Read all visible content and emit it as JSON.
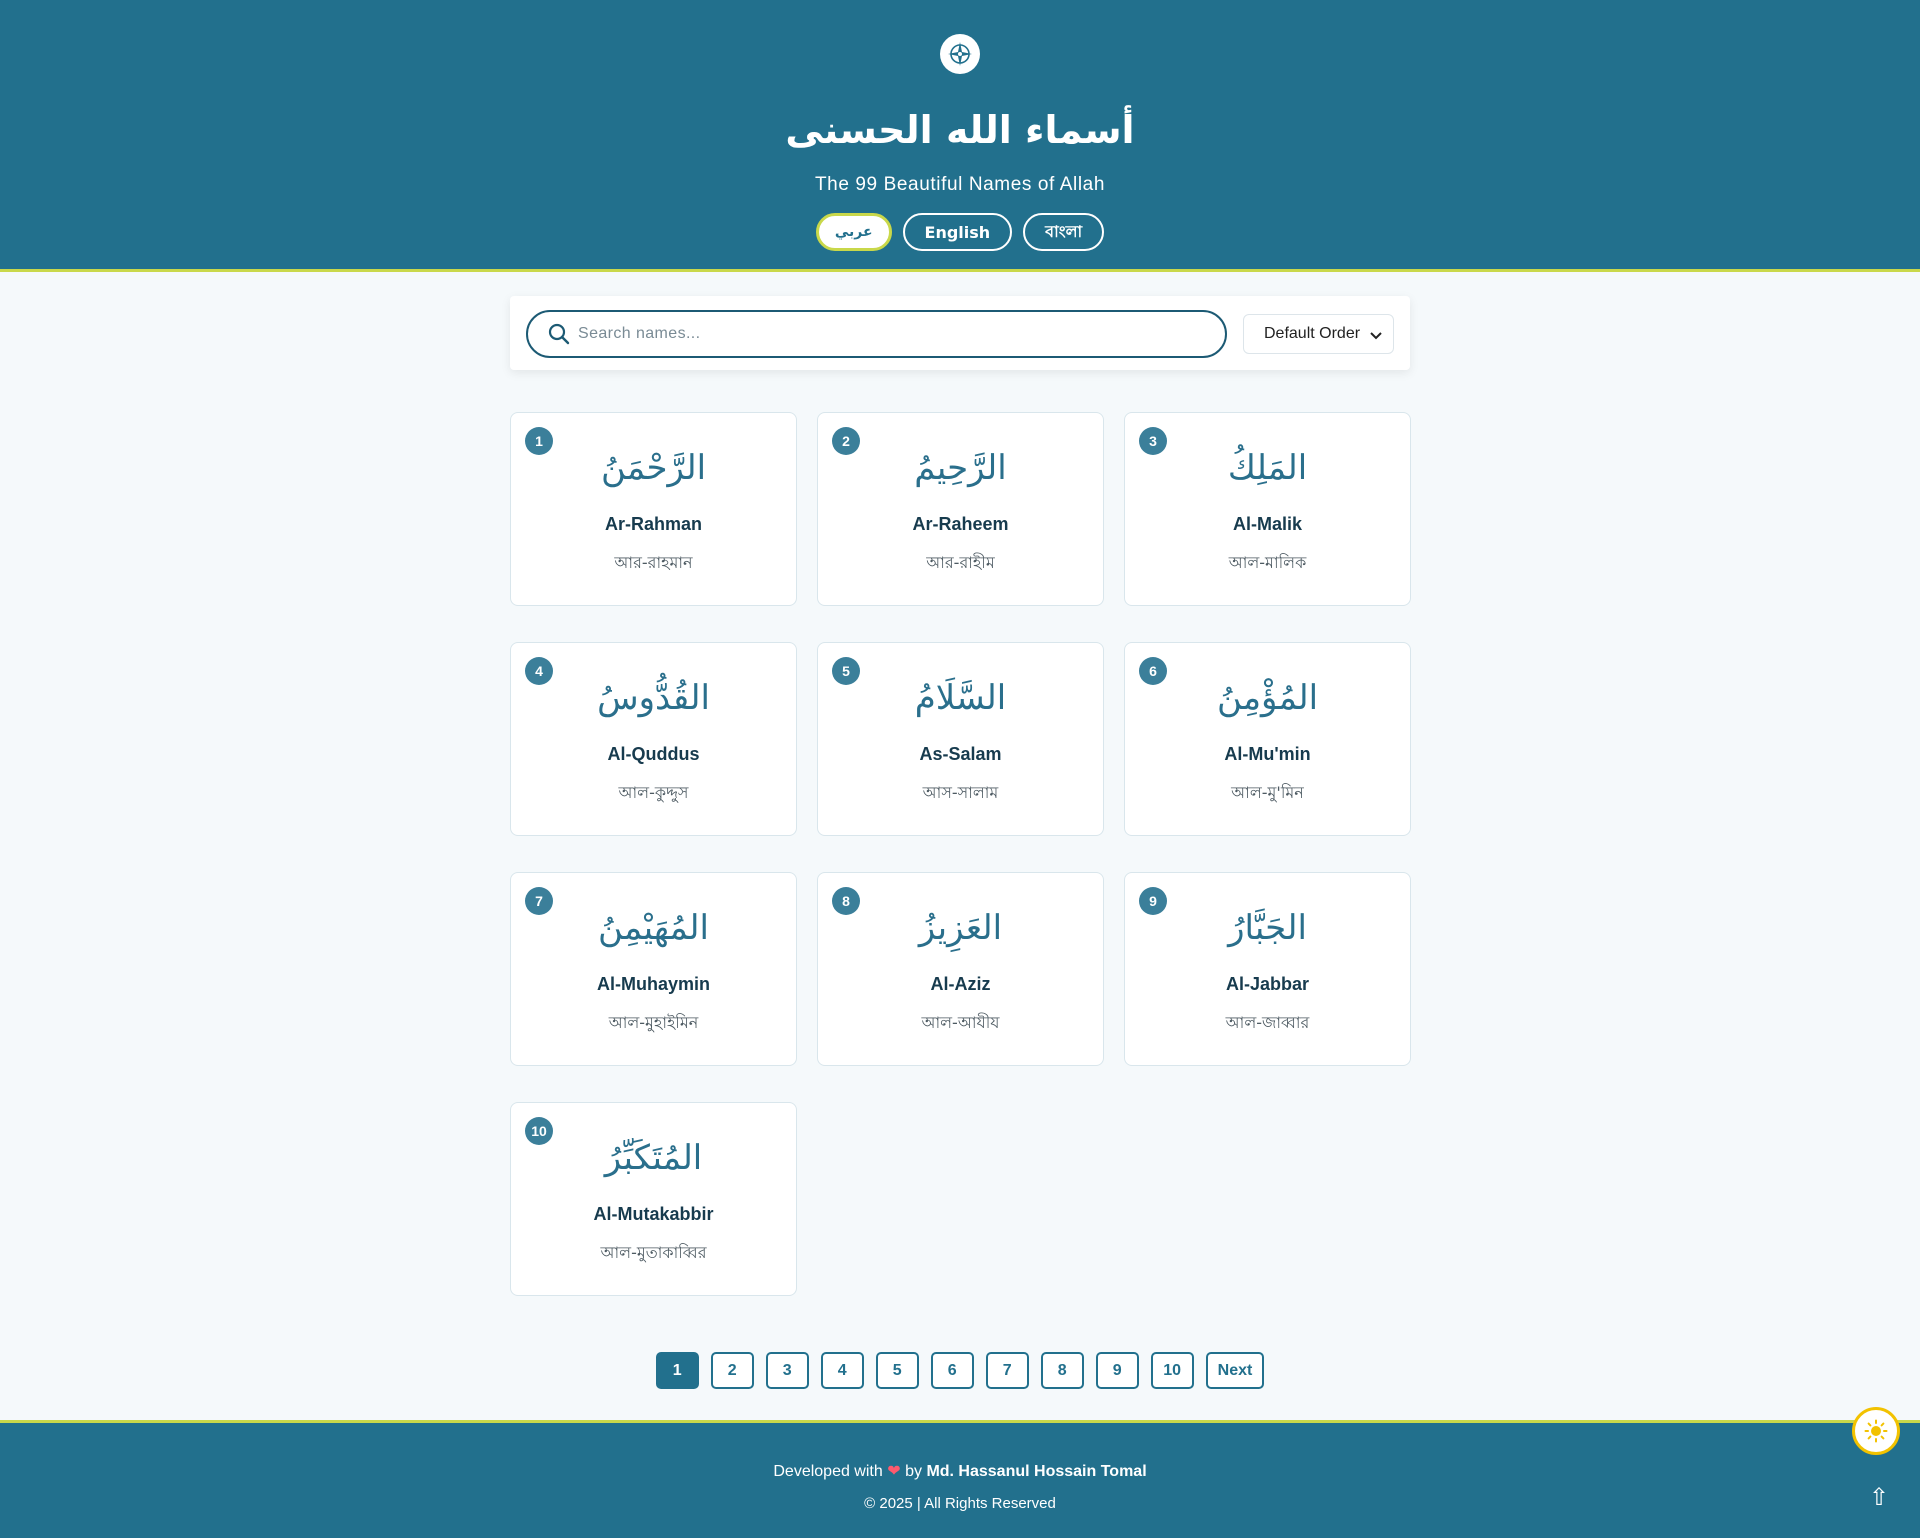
{
  "header": {
    "logo_icon": "compass-icon",
    "title_arabic": "أسماء الله الحسنى",
    "subtitle": "The 99 Beautiful Names of Allah",
    "languages": [
      {
        "label": "عربي",
        "active": true
      },
      {
        "label": "English",
        "active": false
      },
      {
        "label": "বাংলা",
        "active": false
      }
    ]
  },
  "search": {
    "placeholder": "Search names...",
    "value": "",
    "sort_selected": "Default Order"
  },
  "names": [
    {
      "number": "1",
      "arabic": "الرَّحْمَنُ",
      "english": "Ar-Rahman",
      "bengali": "আর-রাহমান"
    },
    {
      "number": "2",
      "arabic": "الرَّحِيمُ",
      "english": "Ar-Raheem",
      "bengali": "আর-রাহীম"
    },
    {
      "number": "3",
      "arabic": "المَلِكُ",
      "english": "Al-Malik",
      "bengali": "আল-মালিক"
    },
    {
      "number": "4",
      "arabic": "القُدُّوسُ",
      "english": "Al-Quddus",
      "bengali": "আল-কুদ্দুস"
    },
    {
      "number": "5",
      "arabic": "السَّلَامُ",
      "english": "As-Salam",
      "bengali": "আস-সালাম"
    },
    {
      "number": "6",
      "arabic": "المُؤْمِنُ",
      "english": "Al-Mu'min",
      "bengali": "আল-মু'মিন"
    },
    {
      "number": "7",
      "arabic": "المُهَيْمِنُ",
      "english": "Al-Muhaymin",
      "bengali": "আল-মুহাইমিন"
    },
    {
      "number": "8",
      "arabic": "العَزِيزُ",
      "english": "Al-Aziz",
      "bengali": "আল-আযীয"
    },
    {
      "number": "9",
      "arabic": "الجَبَّارُ",
      "english": "Al-Jabbar",
      "bengali": "আল-জাব্বার"
    },
    {
      "number": "10",
      "arabic": "المُتَكَبِّرُ",
      "english": "Al-Mutakabbir",
      "bengali": "আল-মুতাকাব্বির"
    }
  ],
  "pagination": {
    "pages": [
      "1",
      "2",
      "3",
      "4",
      "5",
      "6",
      "7",
      "8",
      "9",
      "10"
    ],
    "current": "1",
    "next_label": "Next"
  },
  "footer": {
    "developed_prefix": "Developed with",
    "heart": "❤",
    "by": "by",
    "developer": "Md. Hassanul Hossain Tomal",
    "copyright": "© 2025 | All Rights Reserved"
  },
  "controls": {
    "theme_icon": "sun-icon",
    "scroll_top_icon": "arrow-up-icon",
    "scroll_top_glyph": "⇧"
  },
  "colors": {
    "primary": "#22708d",
    "accent": "#c9d84a",
    "badge": "#3b7f9a",
    "sun": "#f2c200"
  }
}
